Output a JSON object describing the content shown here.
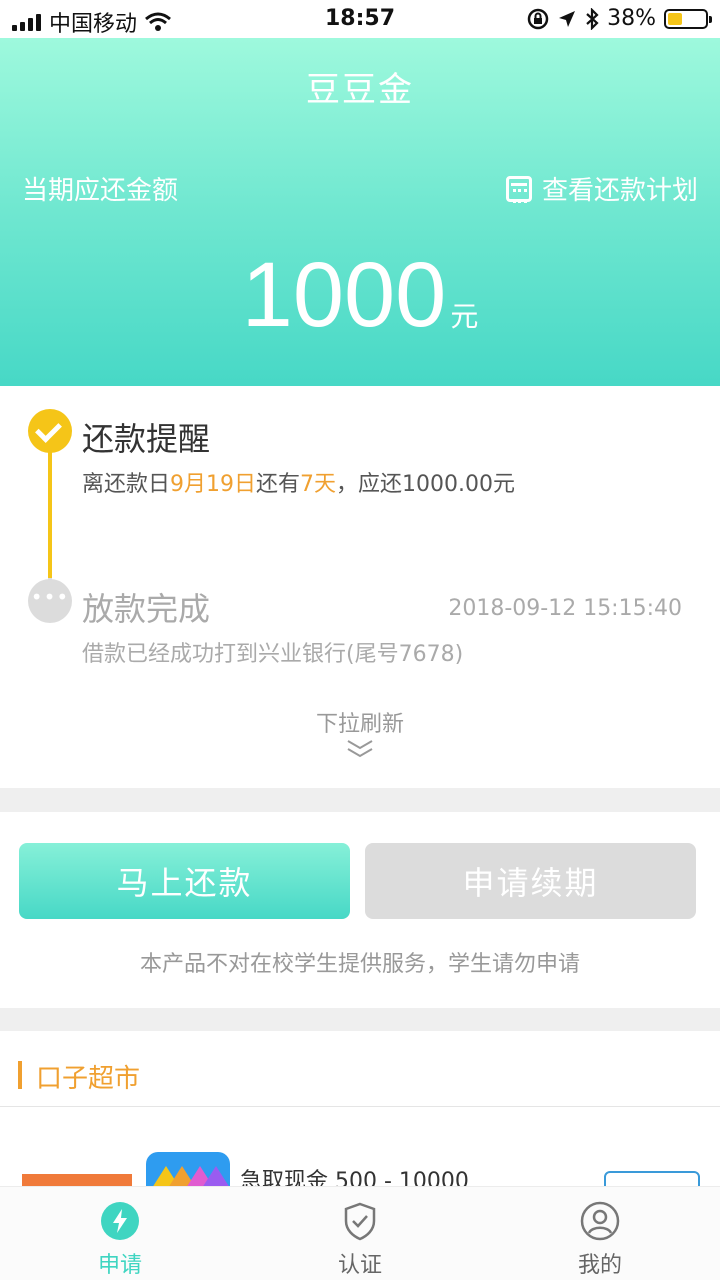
{
  "status_bar": {
    "carrier": "中国移动",
    "time": "18:57",
    "battery": "38%",
    "battery_level": 0.38
  },
  "hero": {
    "app_title": "豆豆金",
    "amount_label": "当期应还金额",
    "plan_link": "查看还款计划",
    "amount": "1000",
    "unit": "元"
  },
  "timeline": {
    "step1_title": "还款提醒",
    "step1_prefix": "离还款日",
    "step1_date": "9月19日",
    "step1_mid": "还有",
    "step1_days": "7天",
    "step1_suffix": "，应还1000.00元",
    "step2_title": "放款完成",
    "step2_time": "2018-09-12 15:15:40",
    "step2_sub": "借款已经成功打到兴业银行(尾号7678)",
    "pull_hint": "下拉刷新"
  },
  "actions": {
    "repay_label": "马上还款",
    "renew_label": "申请续期",
    "notice": "本产品不对在校学生提供服务，学生请勿申请"
  },
  "market": {
    "title": "口子超市",
    "item_name": "急取现金 500 - 10000"
  },
  "tabbar": {
    "tabs": [
      {
        "label": "申请",
        "icon": "lightning-icon"
      },
      {
        "label": "认证",
        "icon": "shield-check-icon"
      },
      {
        "label": "我的",
        "icon": "user-icon"
      }
    ]
  },
  "colors": {
    "accent": "#47d8c6",
    "highlight": "#f0a030",
    "check": "#f5c518"
  }
}
